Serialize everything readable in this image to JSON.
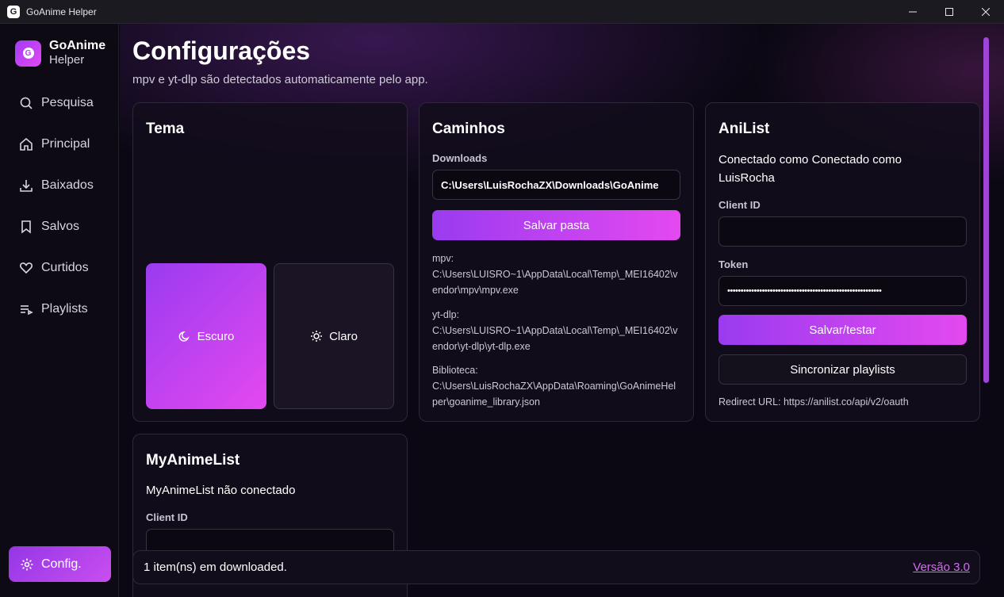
{
  "window": {
    "title": "GoAnime Helper",
    "app_icon": "G"
  },
  "sidebar": {
    "brand_name": "GoAnime",
    "brand_sub": "Helper",
    "logo_letter": "G",
    "items": [
      {
        "label": "Pesquisa",
        "icon": "search-icon"
      },
      {
        "label": "Principal",
        "icon": "home-icon"
      },
      {
        "label": "Baixados",
        "icon": "download-icon"
      },
      {
        "label": "Salvos",
        "icon": "bookmark-icon"
      },
      {
        "label": "Curtidos",
        "icon": "heart-icon"
      },
      {
        "label": "Playlists",
        "icon": "playlist-icon"
      }
    ],
    "config_label": "Config."
  },
  "header": {
    "title": "Configurações",
    "subtitle": "mpv e yt-dlp são detectados automaticamente pelo app."
  },
  "tema": {
    "title": "Tema",
    "dark_label": "Escuro",
    "light_label": "Claro"
  },
  "caminhos": {
    "title": "Caminhos",
    "downloads_label": "Downloads",
    "downloads_value": "C:\\Users\\LuisRochaZX\\Downloads\\GoAnime",
    "save_button": "Salvar pasta",
    "mpv_label": "mpv:",
    "mpv_path_1": "C:\\Users\\LUISRO~1\\AppData\\Local\\Temp\\_MEI16402\\v",
    "mpv_path_2": "endor\\mpv\\mpv.exe",
    "ytdlp_label": "yt-dlp:",
    "ytdlp_path_1": "C:\\Users\\LUISRO~1\\AppData\\Local\\Temp\\_MEI16402\\v",
    "ytdlp_path_2": "endor\\yt-dlp\\yt-dlp.exe",
    "library_label": "Biblioteca:",
    "library_path_1": "C:\\Users\\LuisRochaZX\\AppData\\Roaming\\GoAnimeHel",
    "library_path_2": "per\\goanime_library.json"
  },
  "anilist": {
    "title": "AniList",
    "status_line_1": "Conectado como Conectado como",
    "status_line_2": "LuisRocha",
    "client_id_label": "Client ID",
    "client_id_value": "",
    "token_label": "Token",
    "token_value": "••••••••••••••••••••••••••••••••••••••••••••••••••••••••••",
    "save_button": "Salvar/testar",
    "sync_button": "Sincronizar playlists",
    "redirect_label": "Redirect URL: https://anilist.co/api/v2/oauth"
  },
  "mal": {
    "title": "MyAnimeList",
    "status": "MyAnimeList não conectado",
    "client_id_label": "Client ID",
    "client_id_value": ""
  },
  "footer": {
    "status": "1 item(ns) em downloaded.",
    "version": "Versão 3.0"
  }
}
